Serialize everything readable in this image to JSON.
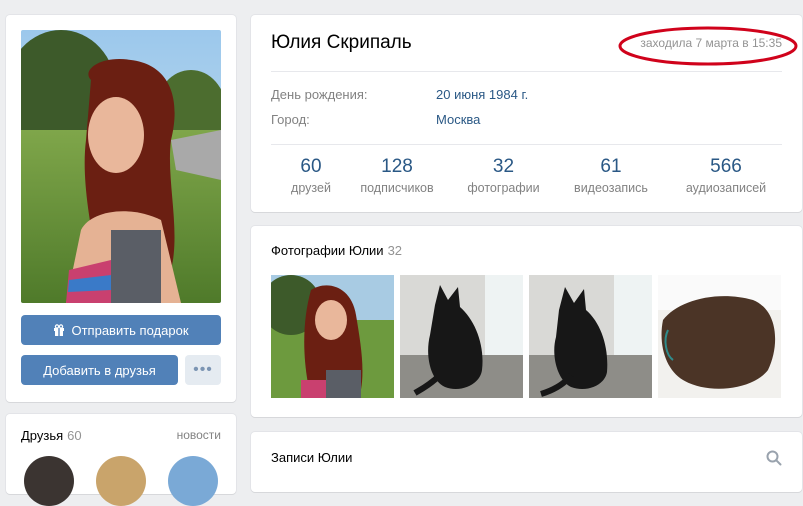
{
  "profile": {
    "name": "Юлия Скрипаль",
    "last_seen": "заходила 7 марта в 15:35",
    "birthday_label": "День рождения:",
    "birthday_value": "20 июня 1984 г.",
    "city_label": "Город:",
    "city_value": "Москва"
  },
  "counters": [
    {
      "num": "60",
      "label": "друзей"
    },
    {
      "num": "128",
      "label": "подписчиков"
    },
    {
      "num": "32",
      "label": "фотографии"
    },
    {
      "num": "61",
      "label": "видеозапись"
    },
    {
      "num": "566",
      "label": "аудиозаписей"
    }
  ],
  "actions": {
    "gift_label": "Отправить подарок",
    "add_friend_label": "Добавить в друзья",
    "more_label": "•••"
  },
  "friends": {
    "title": "Друзья",
    "count": "60",
    "new_label": "новости"
  },
  "photos": {
    "title": "Фотографии Юлии",
    "count": "32"
  },
  "wall": {
    "title": "Записи Юлии"
  },
  "icons": {
    "gift": "gift-icon",
    "search": "search-icon"
  },
  "colors": {
    "accent": "#5181b8",
    "link": "#2a5885",
    "highlight_ellipse": "#d0021b"
  }
}
